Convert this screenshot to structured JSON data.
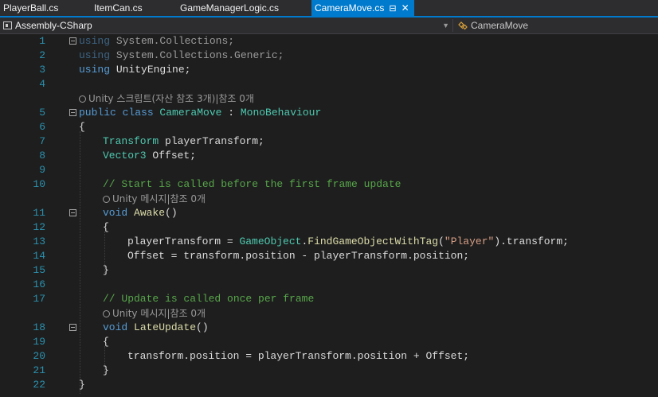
{
  "tabs": [
    {
      "label": "PlayerBall.cs",
      "active": false
    },
    {
      "label": "ItemCan.cs",
      "active": false
    },
    {
      "label": "GameManagerLogic.cs",
      "active": false
    },
    {
      "label": "CameraMove.cs",
      "active": true
    }
  ],
  "tab_pin_icon": "pin-icon",
  "tab_close_icon": "close-icon",
  "navbar": {
    "project": "Assembly-CSharp",
    "member": "CameraMove"
  },
  "lens": {
    "class_ref": "Unity 스크립트(자산 참조 3개)|참조 0개",
    "awake_ref": "Unity 메시지|참조 0개",
    "update_ref": "Unity 메시지|참조 0개"
  },
  "line_numbers": [
    "1",
    "2",
    "3",
    "4",
    "5",
    "6",
    "7",
    "8",
    "9",
    "10",
    "11",
    "12",
    "13",
    "14",
    "15",
    "16",
    "17",
    "18",
    "19",
    "20",
    "21",
    "22"
  ],
  "code": {
    "l1_kw": "using",
    "l1_rest": " System.Collections;",
    "l2_kw": "using",
    "l2_rest": " System.Collections.Generic;",
    "l3_kw": "using",
    "l3_rest": " UnityEngine;",
    "l5_public": "public",
    "l5_class": " class ",
    "l5_name": "CameraMove",
    "l5_colon": " : ",
    "l5_base": "MonoBehaviour",
    "l6": "{",
    "l7_type": "Transform",
    "l7_rest": " playerTransform;",
    "l8_type": "Vector3",
    "l8_rest": " Offset;",
    "l10_comment": "// Start is called before the first frame update",
    "l11_kw": "void",
    "l11_fn": " Awake",
    "l11_rest": "()",
    "l12": "{",
    "l13_a": "playerTransform = ",
    "l13_type": "GameObject",
    "l13_dot": ".",
    "l13_fn": "FindGameObjectWithTag",
    "l13_open": "(",
    "l13_str": "\"Player\"",
    "l13_close": ").transform;",
    "l14": "Offset = transform.position - playerTransform.position;",
    "l15": "}",
    "l17_comment": "// Update is called once per frame",
    "l18_kw": "void",
    "l18_fn": " LateUpdate",
    "l18_rest": "()",
    "l19": "{",
    "l20": "transform.position = playerTransform.position + Offset;",
    "l21": "}",
    "l22": "}"
  },
  "colors": {
    "keyword": "#569cd6",
    "type": "#4ec9b0",
    "comment": "#57a64a",
    "string": "#d69d85",
    "method": "#dcdcaa",
    "line_number": "#2b91af",
    "accent": "#007acc"
  }
}
